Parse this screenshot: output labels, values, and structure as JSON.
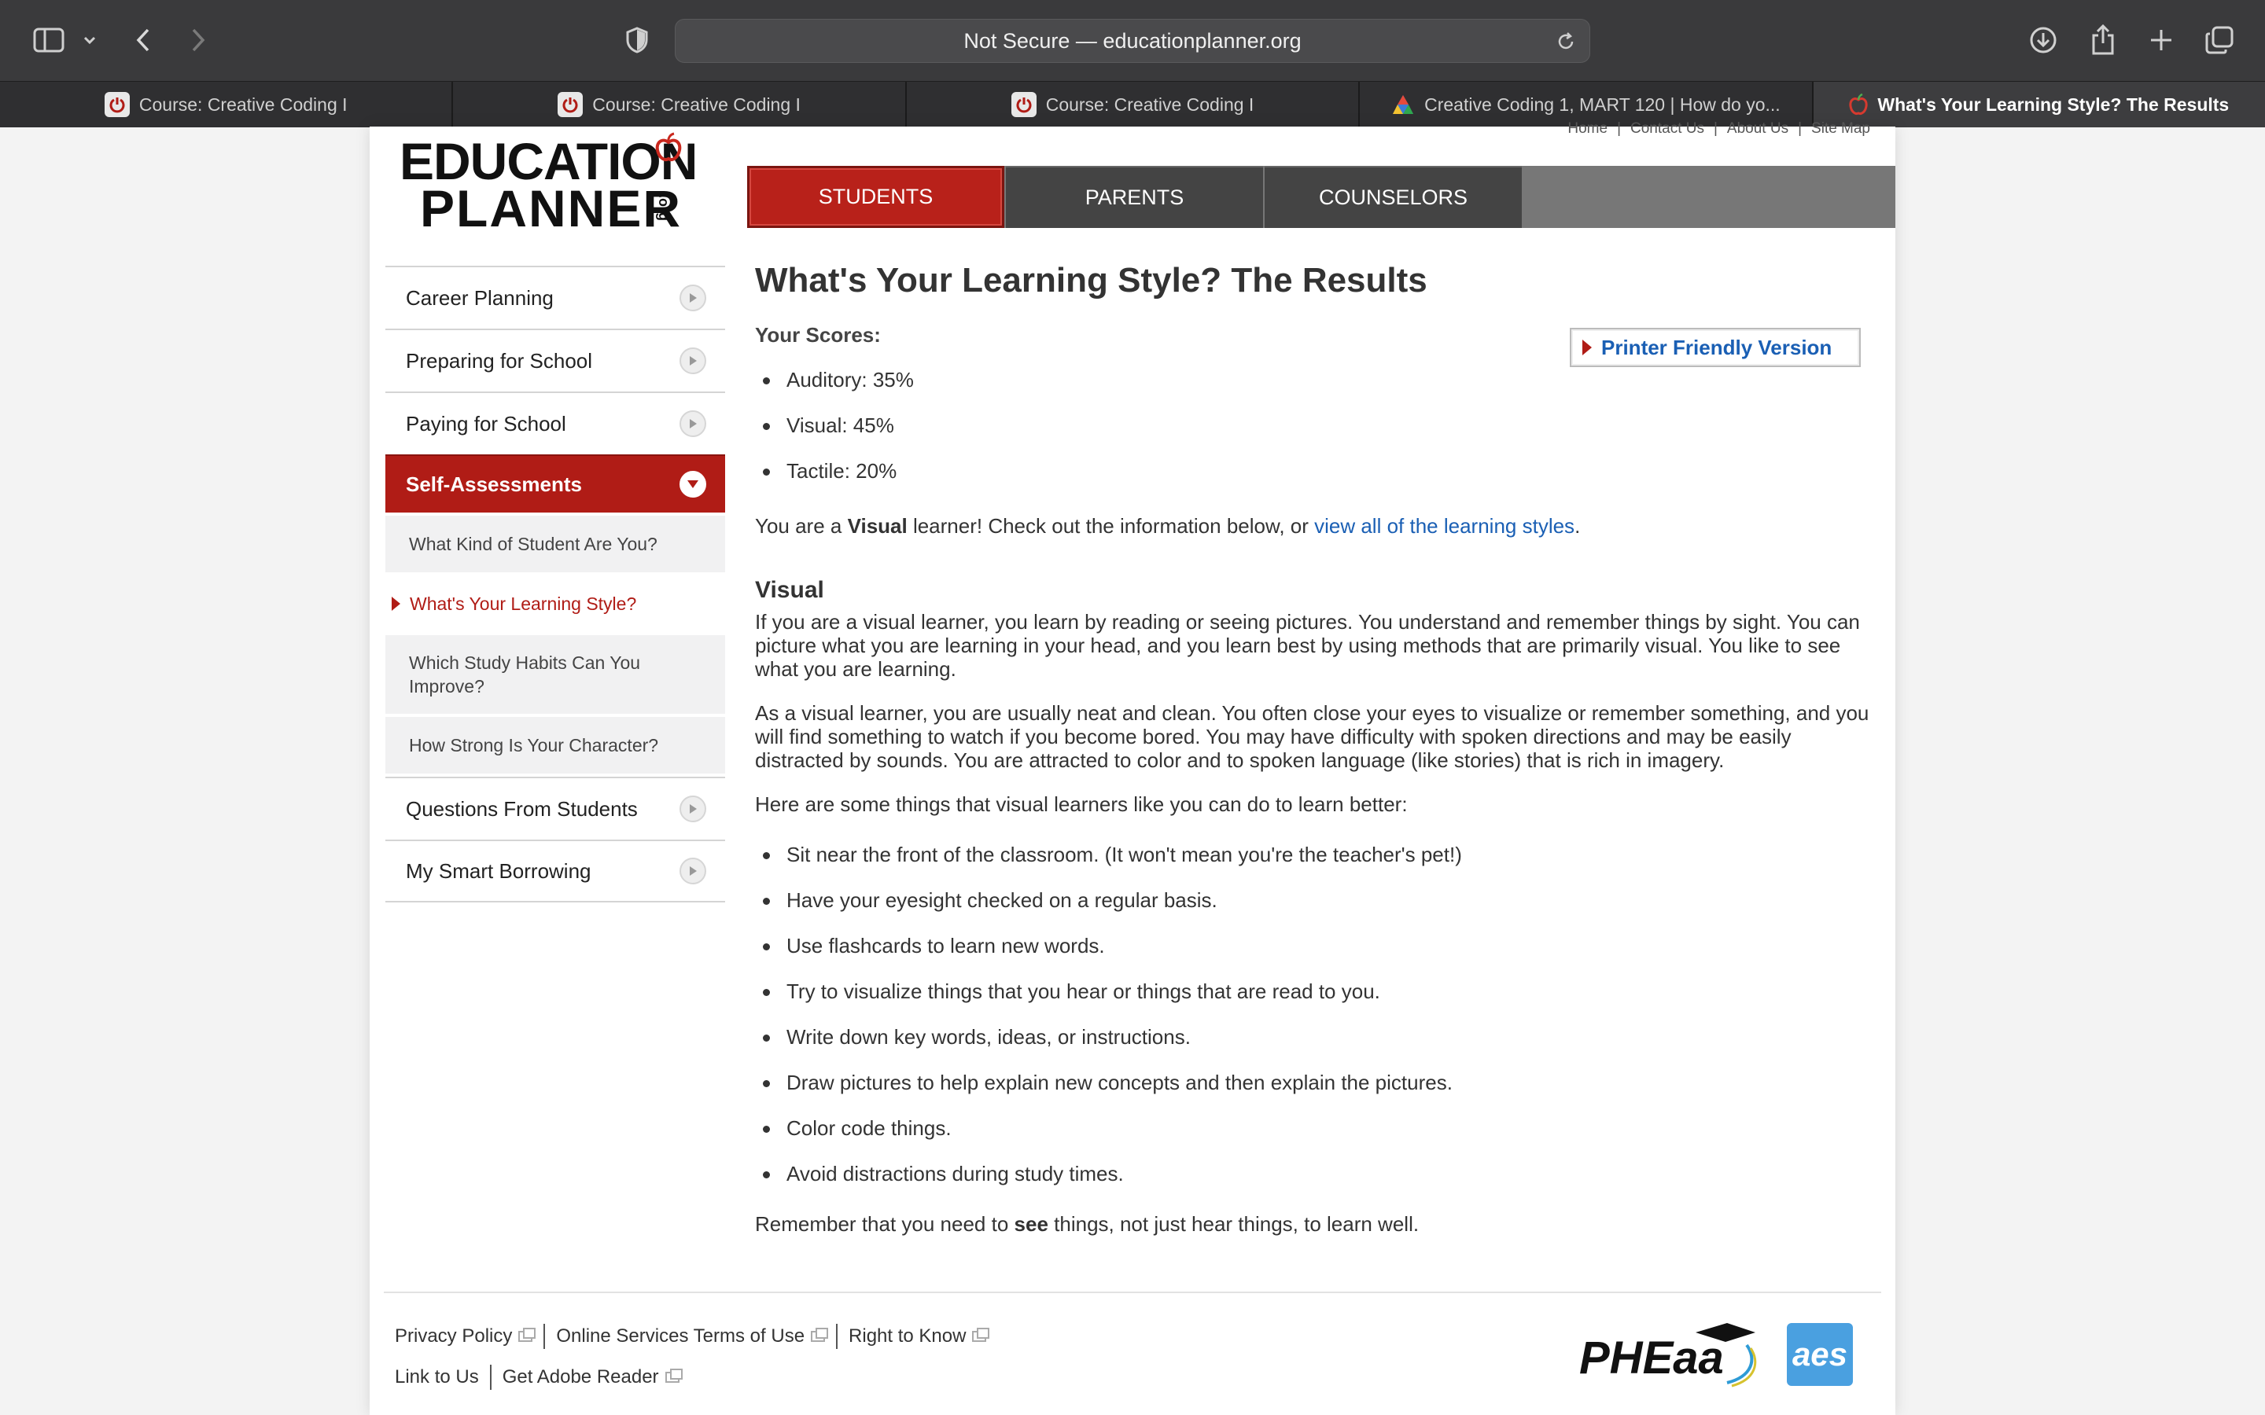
{
  "browser": {
    "address": "Not Secure — educationplanner.org",
    "tabs": [
      {
        "label": "Course: Creative Coding I"
      },
      {
        "label": "Course: Creative Coding I"
      },
      {
        "label": "Course: Creative Coding I"
      },
      {
        "label": "Creative Coding 1, MART 120 | How do yo..."
      },
      {
        "label": "What's Your Learning Style? The Results"
      }
    ]
  },
  "logo": {
    "line1": "EDUCATION",
    "line2": "PLANNER",
    "suffix": ".org"
  },
  "utility_links": [
    "Home",
    "Contact Us",
    "About Us",
    "Site Map"
  ],
  "mainnav": [
    "STUDENTS",
    "PARENTS",
    "COUNSELORS"
  ],
  "sidebar": {
    "items": [
      {
        "label": "Career Planning"
      },
      {
        "label": "Preparing for School"
      },
      {
        "label": "Paying for School"
      },
      {
        "label": "Self-Assessments"
      },
      {
        "label": "Questions From Students"
      },
      {
        "label": "My Smart Borrowing"
      }
    ],
    "subitems": [
      {
        "label": "What Kind of Student Are You?"
      },
      {
        "label": "What's Your Learning Style?"
      },
      {
        "label": "Which Study Habits Can You Improve?"
      },
      {
        "label": "How Strong Is Your Character?"
      }
    ]
  },
  "content": {
    "title": "What's Your Learning Style? The Results",
    "scores_label": "Your Scores:",
    "printer_label": "Printer Friendly Version",
    "scores": [
      "Auditory: 35%",
      "Visual: 45%",
      "Tactile: 20%"
    ],
    "result_prefix": "You are a ",
    "result_style": "Visual",
    "result_middle": " learner! Check out the information below, or ",
    "result_link": "view all of the learning styles",
    "result_end": ".",
    "section_title": "Visual",
    "para1": "If you are a visual learner, you learn by reading or seeing pictures. You understand and remember things by sight. You can picture what you are learning in your head, and you learn best by using methods that are primarily visual. You like to see what you are learning.",
    "para2": "As a visual learner, you are usually neat and clean. You often close your eyes to visualize or remember something, and you will find something to watch if you become bored. You may have difficulty with spoken directions and may be easily distracted by sounds. You are attracted to color and to spoken language (like stories) that is rich in imagery.",
    "para3": "Here are some things that visual learners like you can do to learn better:",
    "tips": [
      "Sit near the front of the classroom. (It won't mean you're the teacher's pet!)",
      "Have your eyesight checked on a regular basis.",
      "Use flashcards to learn new words.",
      "Try to visualize things that you hear or things that are read to you.",
      "Write down key words, ideas, or instructions.",
      "Draw pictures to help explain new concepts and then explain the pictures.",
      "Color code things.",
      "Avoid distractions during study times."
    ],
    "closing_prefix": "Remember that you need to ",
    "closing_bold": "see",
    "closing_end": " things, not just hear things, to learn well."
  },
  "footer": {
    "row1": [
      "Privacy Policy",
      "Online Services Terms of Use",
      "Right to Know"
    ],
    "row2": [
      "Link to Us",
      "Get Adobe Reader"
    ],
    "pheaa": "PHEaa",
    "aes": "aes"
  },
  "colors": {
    "brand_red": "#b01c16",
    "link_blue": "#1a5fb4",
    "nav_gray": "#444444"
  }
}
